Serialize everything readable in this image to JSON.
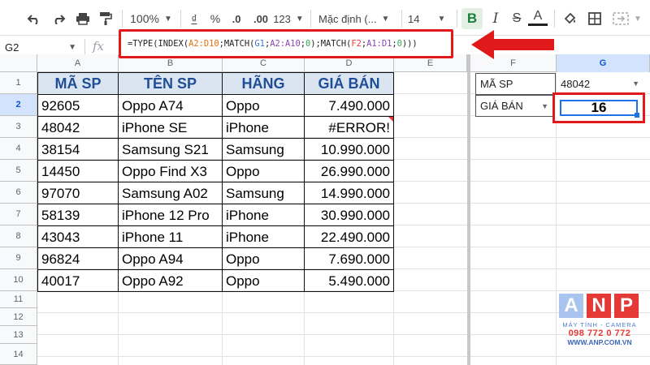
{
  "toolbar": {
    "zoom": "100%",
    "currency": "₫",
    "percent": "%",
    "dec_decrease": ".0",
    "dec_increase": ".00",
    "format_more": "123",
    "font": "Mặc định (...",
    "font_size": "14",
    "bold": "B",
    "italic": "I",
    "strike": "S",
    "text_color": "A"
  },
  "namebox": "G2",
  "fx_label": "fx",
  "formula": {
    "p1": "=TYPE(INDEX(",
    "r1": "A2:D10",
    "p2": ";MATCH(",
    "r2": "G1",
    "p3": ";",
    "r3": "A2:A10",
    "p4": ";",
    "r4": "0",
    "p5": ");MATCH(",
    "r5": "F2",
    "p6": ";",
    "r6": "A1:D1",
    "p7": ";",
    "r7": "0",
    "p8": ")))"
  },
  "columns": [
    "A",
    "B",
    "C",
    "D",
    "E",
    "F",
    "G"
  ],
  "rows": [
    "1",
    "2",
    "3",
    "4",
    "5",
    "6",
    "7",
    "8",
    "9",
    "10",
    "11",
    "12",
    "13",
    "14"
  ],
  "table": {
    "headers": [
      "MÃ SP",
      "TÊN SP",
      "HÃNG",
      "GIÁ BÁN"
    ],
    "data": [
      [
        "92605",
        "Oppo A74",
        "Oppo",
        "7.490.000"
      ],
      [
        "48042",
        "iPhone SE",
        "iPhone",
        "#ERROR!"
      ],
      [
        "38154",
        "Samsung S21",
        "Samsung",
        "10.990.000"
      ],
      [
        "14450",
        "Oppo Find X3",
        "Oppo",
        "26.990.000"
      ],
      [
        "97070",
        "Samsung A02",
        "Samsung",
        "14.990.000"
      ],
      [
        "58139",
        "iPhone 12 Pro",
        "iPhone",
        "30.990.000"
      ],
      [
        "43043",
        "iPhone 11",
        "iPhone",
        "22.490.000"
      ],
      [
        "96824",
        "Oppo A94",
        "Oppo",
        "7.690.000"
      ],
      [
        "40017",
        "Oppo A92",
        "Oppo",
        "5.490.000"
      ]
    ]
  },
  "lookup": {
    "f1": "MÃ SP",
    "g1": "48042",
    "f2": "GIÁ BÁN",
    "g2": "16"
  },
  "logo": {
    "letters": [
      "A",
      "N",
      "P"
    ],
    "tagline": "MÁY TÍNH - CAMERA",
    "phone": "098 772 0 772",
    "web": "WWW.ANP.COM.VN",
    "colors": [
      "#a9c4ee",
      "#e53935",
      "#e53935"
    ]
  },
  "colors": {
    "header_fill": "#dbe5f1",
    "header_text": "#1f4e96",
    "highlight": "#e01a1a",
    "selection": "#1a73e8"
  }
}
